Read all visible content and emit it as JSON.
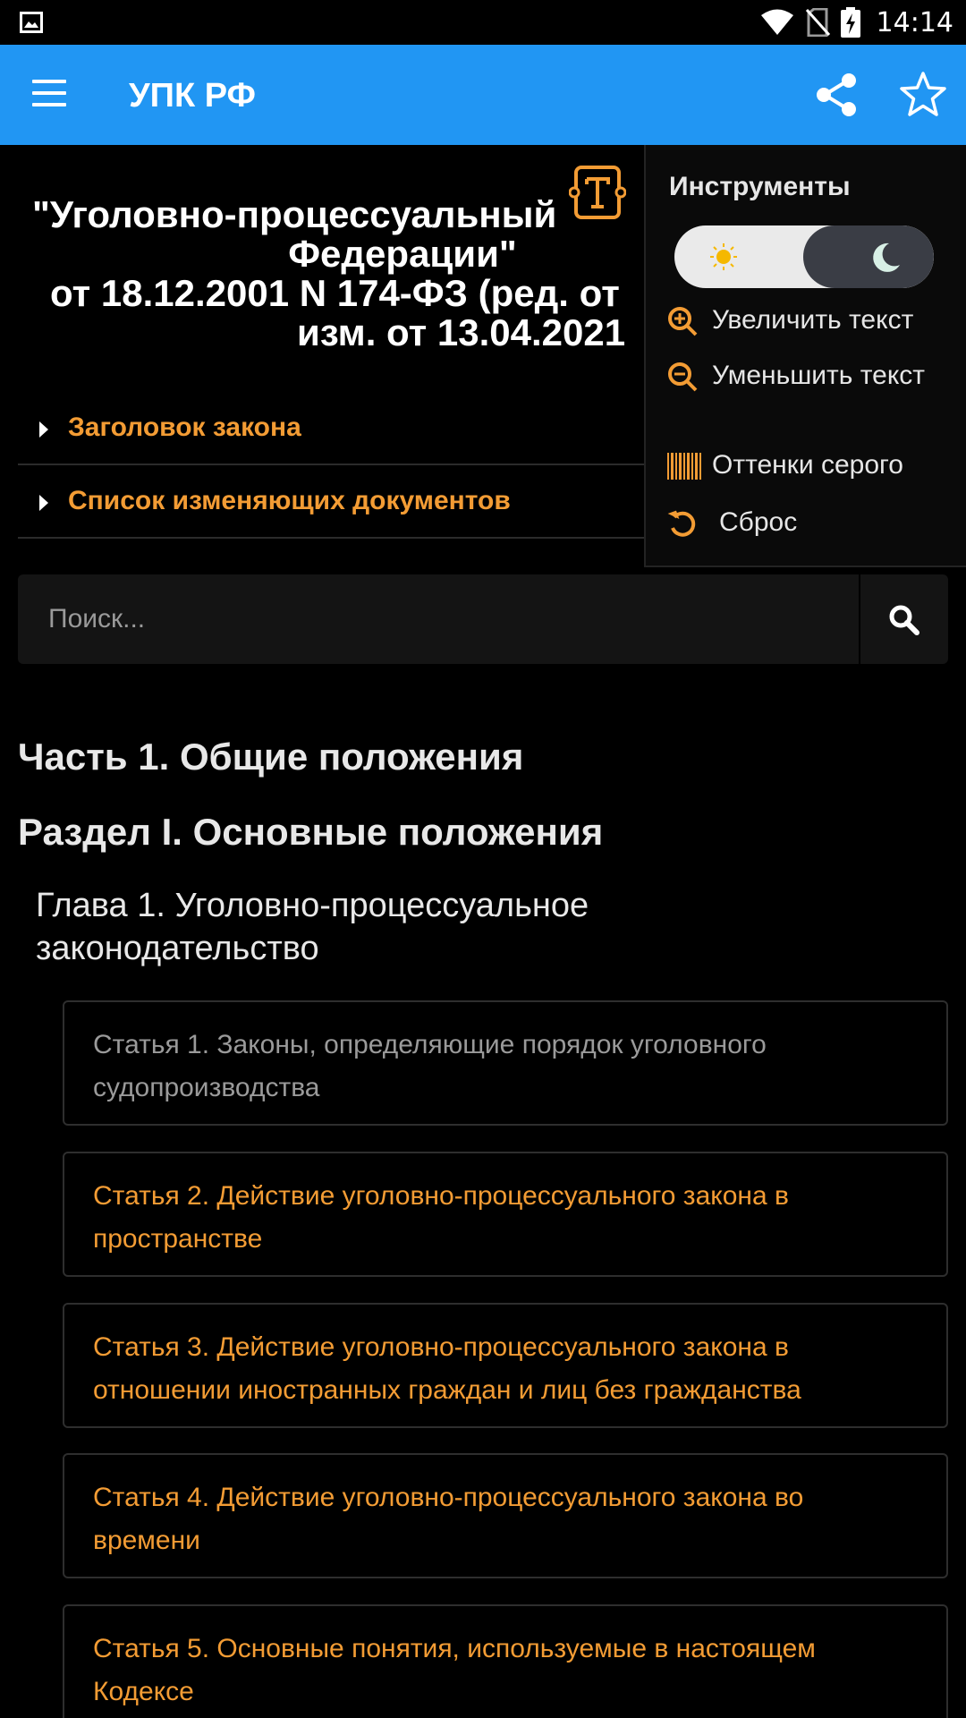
{
  "status_bar": {
    "time": "14:14",
    "icons": [
      "gallery-icon",
      "wifi-icon",
      "no-sim-icon",
      "battery-charging-icon"
    ]
  },
  "appbar": {
    "title": "УПК РФ",
    "color": "#2196f3",
    "icons": [
      "menu-icon",
      "share-icon",
      "star-icon"
    ]
  },
  "document": {
    "title_lines": [
      "\"Уголовно-процессуальный",
      "Федерации\"",
      "от 18.12.2001 N 174-ФЗ (ред. от",
      "изм. от 13.04.2021"
    ],
    "accordion": [
      {
        "label": "Заголовок закона"
      },
      {
        "label": "Список изменяющих документов"
      }
    ]
  },
  "tools": {
    "title": "Инструменты",
    "theme_toggle": {
      "selected": "dark"
    },
    "items": [
      {
        "label": "Увеличить текст",
        "icon": "zoom-in-icon"
      },
      {
        "label": "Уменьшить текст",
        "icon": "zoom-out-icon"
      },
      {
        "label": "Оттенки серого",
        "icon": "grayscale-icon"
      },
      {
        "label": "Сброс",
        "icon": "reset-icon"
      }
    ]
  },
  "search": {
    "placeholder": "Поиск...",
    "value": ""
  },
  "content": {
    "part": "Часть 1. Общие положения",
    "section": "Раздел I. Основные положения",
    "chapter": "Глава 1. Уголовно-процессуальное законодательство",
    "articles": [
      {
        "text": "Статья 1. Законы, определяющие порядок уголовного судопроизводства",
        "visited": true
      },
      {
        "text": "Статья 2. Действие уголовно-процессуального закона в пространстве",
        "visited": false
      },
      {
        "text": "Статья 3. Действие уголовно-процессуального закона в отношении иностранных граждан и лиц без гражданства",
        "visited": false
      },
      {
        "text": "Статья 4. Действие уголовно-процессуального закона во времени",
        "visited": false
      },
      {
        "text": "Статья 5. Основные понятия, используемые в настоящем Кодексе",
        "visited": false
      }
    ]
  },
  "colors": {
    "accent": "#f39c34",
    "background": "#000000",
    "visited_text": "#9a9a9a"
  }
}
